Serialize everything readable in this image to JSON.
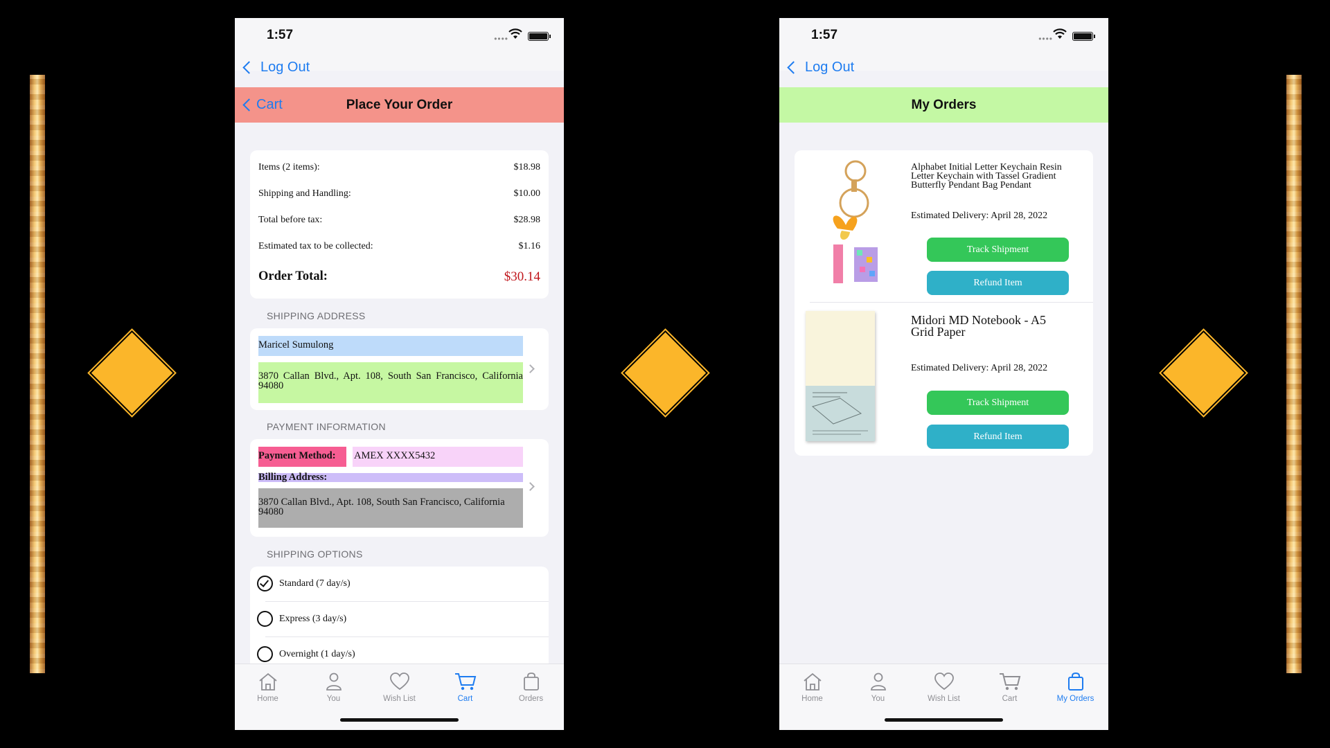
{
  "left_phone": {
    "status_time": "1:57",
    "back_label": "Log Out",
    "nav_title": "Place Your Order",
    "nav_back": "Cart",
    "nav_color": "#f4938a",
    "summary": {
      "rows": [
        {
          "label": "Items (2 items):",
          "value": "$18.98"
        },
        {
          "label": "Shipping and Handling:",
          "value": "$10.00"
        },
        {
          "label": "Total before tax:",
          "value": "$28.98"
        },
        {
          "label": "Estimated tax to be collected:",
          "value": "$1.16"
        }
      ],
      "total_label": "Order Total:",
      "total_value": "$30.14"
    },
    "shipping_section": "SHIPPING ADDRESS",
    "shipping_name": "Maricel Sumulong",
    "shipping_address": "3870 Callan Blvd., Apt. 108, South San Francisco, California 94080",
    "payment_section": "PAYMENT INFORMATION",
    "payment_method_label": "Payment Method:",
    "payment_method_value": "AMEX XXXX5432",
    "billing_label": "Billing Address:",
    "billing_address": "3870 Callan Blvd., Apt. 108, South San Francisco, California 94080",
    "shipping_options_section": "SHIPPING OPTIONS",
    "shipping_options": [
      {
        "label": "Standard (7 day/s)",
        "selected": true
      },
      {
        "label": "Express (3 day/s)",
        "selected": false
      },
      {
        "label": "Overnight (1 day/s)",
        "selected": false
      }
    ],
    "tabs": [
      {
        "label": "Home",
        "icon": "house-icon"
      },
      {
        "label": "You",
        "icon": "person-icon"
      },
      {
        "label": "Wish List",
        "icon": "heart-icon"
      },
      {
        "label": "Cart",
        "icon": "cart-icon",
        "active": true
      },
      {
        "label": "Orders",
        "icon": "bag-icon"
      }
    ]
  },
  "right_phone": {
    "status_time": "1:57",
    "back_label": "Log Out",
    "nav_title": "My Orders",
    "nav_color": "#c4f8a4",
    "orders": [
      {
        "title": "Alphabet Initial Letter Keychain Resin Letter Keychain with Tassel Gradient Butterfly Pendant Bag Pendant",
        "delivery": "Estimated Delivery: April 28, 2022",
        "track": "Track Shipment",
        "refund": "Refund Item"
      },
      {
        "title": "Midori MD Notebook - A5 Grid Paper",
        "delivery": "Estimated Delivery: April 28, 2022",
        "track": "Track Shipment",
        "refund": "Refund Item"
      }
    ],
    "tabs": [
      {
        "label": "Home",
        "icon": "house-icon"
      },
      {
        "label": "You",
        "icon": "person-icon"
      },
      {
        "label": "Wish List",
        "icon": "heart-icon"
      },
      {
        "label": "Cart",
        "icon": "cart-icon"
      },
      {
        "label": "My Orders",
        "icon": "bag-icon",
        "active": true
      }
    ]
  },
  "colors": {
    "accent": "#1e7cf0",
    "total_red": "#c0161c",
    "gold": "#fbb62a"
  }
}
